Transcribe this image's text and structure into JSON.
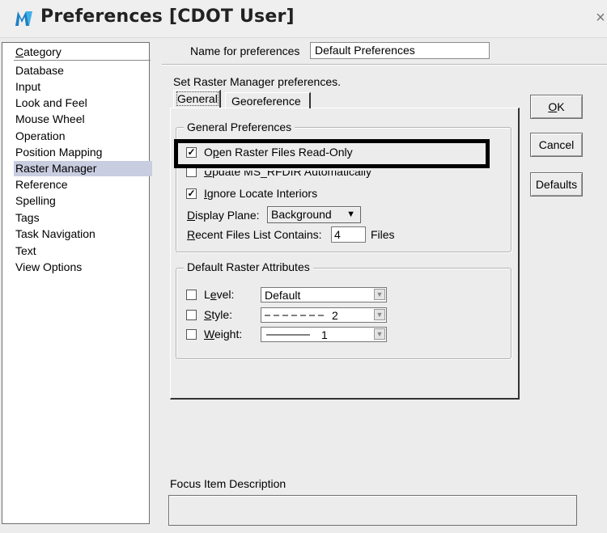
{
  "window": {
    "title": "Preferences [CDOT User]",
    "close_glyph": "×",
    "icon": "microstation-m-icon"
  },
  "category": {
    "header_u": "C",
    "header_rest": "ategory",
    "items": [
      "Database",
      "Input",
      "Look and Feel",
      "Mouse Wheel",
      "Operation",
      "Position Mapping",
      "Raster Manager",
      "Reference",
      "Spelling",
      "Tags",
      "Task Navigation",
      "Text",
      "View Options"
    ],
    "selected": "Raster Manager"
  },
  "name_pref": {
    "label": "Name for preferences",
    "value": "Default Preferences"
  },
  "description": "Set Raster Manager preferences.",
  "tabs": {
    "general": "General",
    "georeference": "Georeference"
  },
  "general_prefs": {
    "legend": "General Preferences",
    "open_raster": {
      "u": "p",
      "pre": "O",
      "post": "en Raster Files Read-Only",
      "checked": true
    },
    "update_rfdir": {
      "u": "U",
      "post": "pdate MS_RFDIR Automatically",
      "checked": false
    },
    "ignore_locate": {
      "u": "I",
      "post": "gnore Locate Interiors",
      "checked": true
    },
    "display_plane": {
      "u": "D",
      "post": "isplay Plane:",
      "value": "Background",
      "arrow": "▼"
    },
    "recent_files": {
      "u": "R",
      "post": "ecent Files List Contains:",
      "value": "4",
      "suffix": "Files"
    }
  },
  "raster_attrs": {
    "legend": "Default Raster Attributes",
    "level": {
      "pre": "L",
      "u": "e",
      "post": "vel:",
      "value": "Default",
      "checked": false
    },
    "style": {
      "u": "S",
      "post": "tyle:",
      "value": "2",
      "checked": false
    },
    "weight": {
      "u": "W",
      "post": "eight:",
      "value": "1",
      "checked": false
    }
  },
  "buttons": {
    "ok_u": "O",
    "ok_rest": "K",
    "cancel": "Cancel",
    "defaults": "Defaults"
  },
  "focus": {
    "label": "Focus Item Description",
    "text": ""
  },
  "colors": {
    "selected_bg": "#c9cde0",
    "dialog_bg": "#ececec",
    "highlight": "#000000"
  }
}
